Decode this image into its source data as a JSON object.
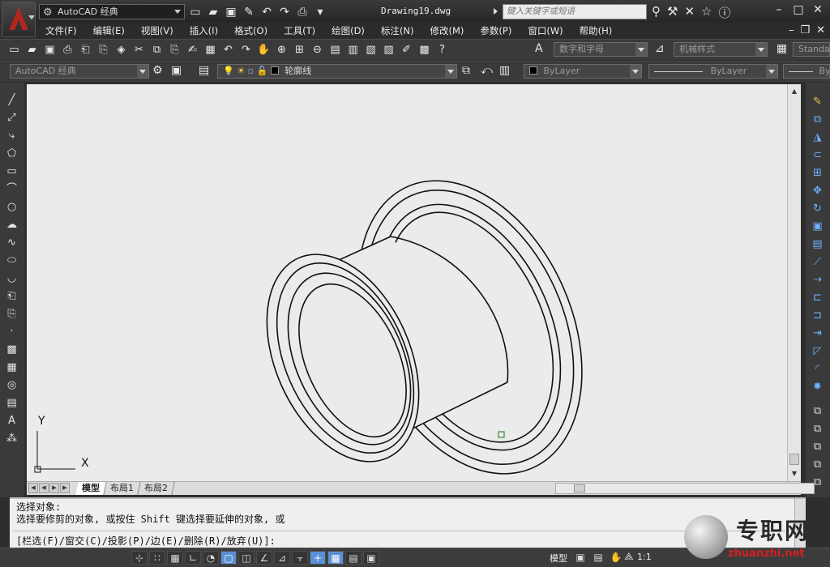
{
  "titlebar": {
    "workspace": "AutoCAD 经典",
    "document_title": "Drawing19.dwg",
    "search_placeholder": "键入关键字或短语"
  },
  "menu": [
    "文件(F)",
    "编辑(E)",
    "视图(V)",
    "插入(I)",
    "格式(O)",
    "工具(T)",
    "绘图(D)",
    "标注(N)",
    "修改(M)",
    "参数(P)",
    "窗口(W)",
    "帮助(H)"
  ],
  "toolbar1": {
    "text_style": "数字和字母",
    "dim_style": "机械样式",
    "table_style": "Standar"
  },
  "toolbar2": {
    "workspace": "AutoCAD 经典",
    "layer": "轮廓线",
    "color": "ByLayer",
    "linetype": "ByLayer",
    "lineweight": "By"
  },
  "tabs": [
    "模型",
    "布局1",
    "布局2"
  ],
  "ucs": {
    "x_label": "X",
    "y_label": "Y"
  },
  "command_line": {
    "line1": "选择对象:",
    "line2": "选择要修剪的对象, 或按住 Shift 键选择要延伸的对象, 或",
    "line3": "[栏选(F)/窗交(C)/投影(P)/边(E)/删除(R)/放弃(U)]:"
  },
  "status_bar": {
    "model": "模型",
    "scale": "1:1"
  },
  "watermark": {
    "cn": "专职网",
    "en": "zhuanzhi.net"
  },
  "colors": {
    "canvas": "#ebebeb",
    "ui_dark": "#3a3a3a",
    "accent": "#5b8fd6"
  }
}
